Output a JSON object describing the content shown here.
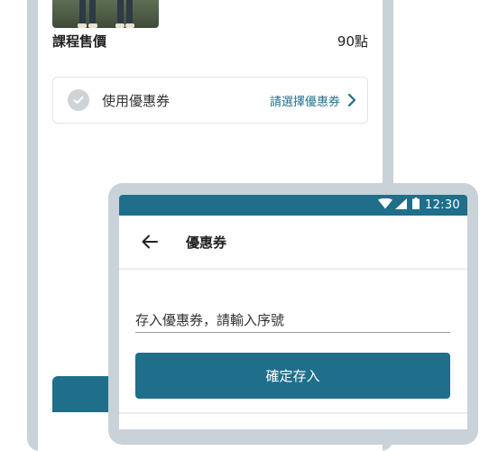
{
  "course": {
    "price_label": "課程售價",
    "price_value": "90點"
  },
  "coupon_row": {
    "label": "使用優惠券",
    "select_text": "請選擇優惠券"
  },
  "status_bar": {
    "time": "12:30"
  },
  "coupon_page": {
    "title": "優惠券",
    "input_placeholder": "存入優惠券，請輸入序號",
    "submit_label": "確定存入"
  },
  "colors": {
    "accent": "#1f6f8b",
    "frame": "#c9d2d8"
  },
  "icons": [
    "check-icon",
    "chevron-right-icon",
    "wifi-icon",
    "signal-icon",
    "battery-icon",
    "back-arrow-icon"
  ]
}
